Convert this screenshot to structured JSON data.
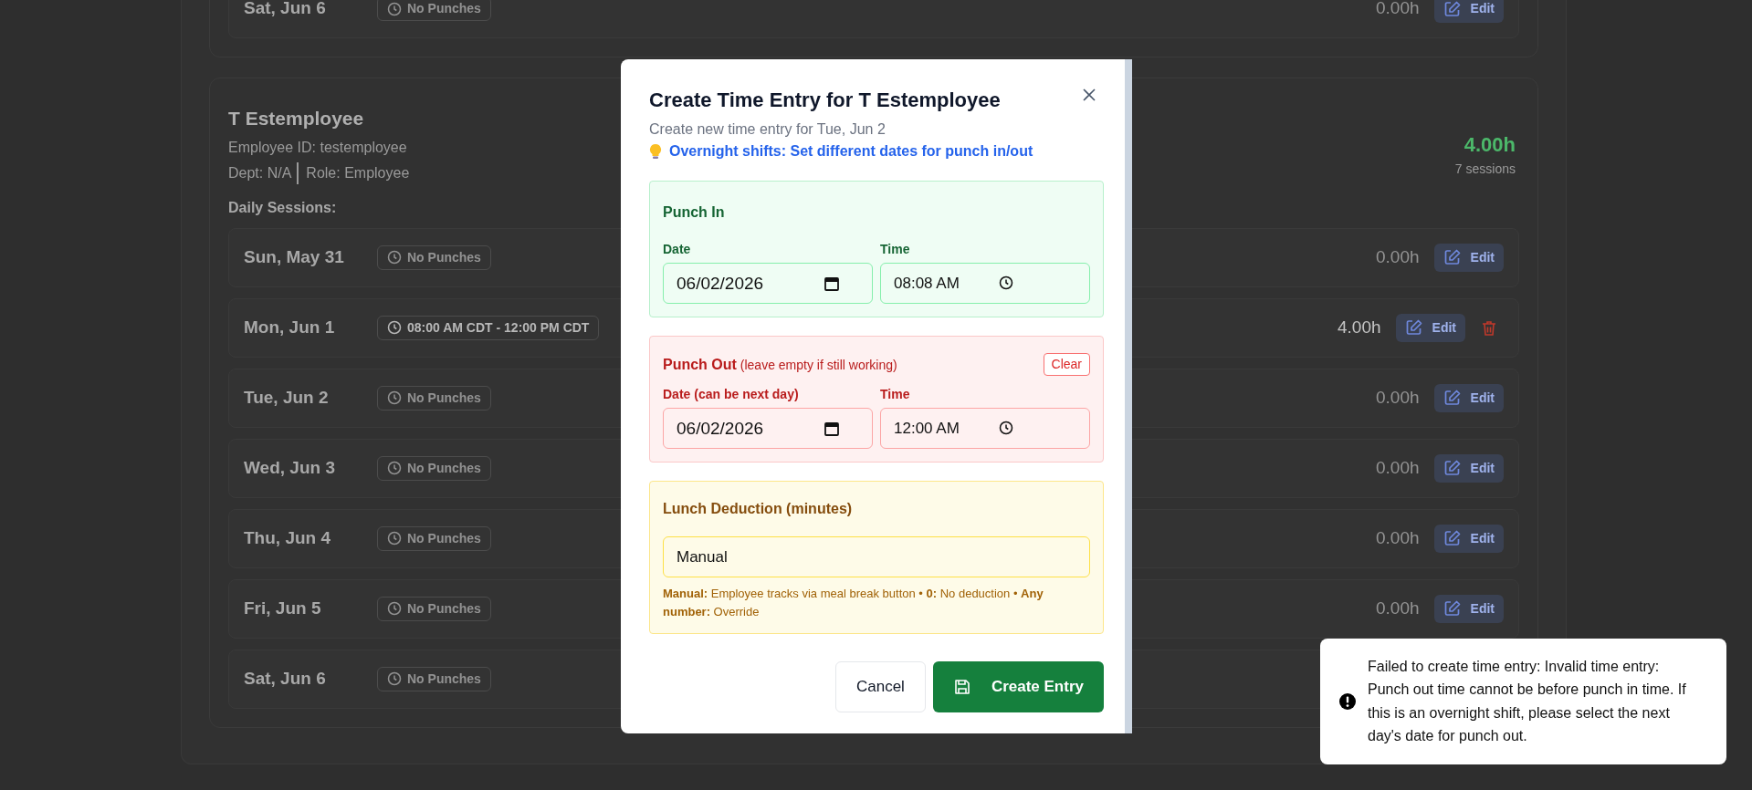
{
  "previous_card": {
    "rows": [
      {
        "day": "Sat, Jun 6",
        "kind": "empty",
        "status": "No Punches",
        "hours": "0.00h",
        "edit": "Edit",
        "deletable": false
      }
    ]
  },
  "employee_card": {
    "name": "T Estemployee",
    "employee_id": "Employee ID: testemployee",
    "dept": "Dept: N/A",
    "role": "Role: Employee",
    "total_hours": "4.00h",
    "sessions": "7 sessions",
    "section_label": "Daily Sessions:",
    "rows": [
      {
        "day": "Sun, May 31",
        "kind": "empty",
        "status": "No Punches",
        "hours": "0.00h",
        "edit": "Edit",
        "deletable": false
      },
      {
        "day": "Mon, Jun 1",
        "kind": "punched",
        "status": "08:00 AM CDT - 12:00 PM CDT",
        "hours": "4.00h",
        "edit": "Edit",
        "deletable": true
      },
      {
        "day": "Tue, Jun 2",
        "kind": "empty",
        "status": "No Punches",
        "hours": "0.00h",
        "edit": "Edit",
        "deletable": false
      },
      {
        "day": "Wed, Jun 3",
        "kind": "empty",
        "status": "No Punches",
        "hours": "0.00h",
        "edit": "Edit",
        "deletable": false
      },
      {
        "day": "Thu, Jun 4",
        "kind": "empty",
        "status": "No Punches",
        "hours": "0.00h",
        "edit": "Edit",
        "deletable": false
      },
      {
        "day": "Fri, Jun 5",
        "kind": "empty",
        "status": "No Punches",
        "hours": "0.00h",
        "edit": "Edit",
        "deletable": false
      },
      {
        "day": "Sat, Jun 6",
        "kind": "empty",
        "status": "No Punches"
      }
    ]
  },
  "modal": {
    "title": "Create Time Entry for T Estemployee",
    "subtitle": "Create new time entry for Tue, Jun 2",
    "tip": "Overnight shifts: Set different dates for punch in/out",
    "sections": [
      {
        "kind": "punch_in",
        "title": "Punch In",
        "fields": [
          {
            "kind": "date",
            "label": "Date",
            "value": "06/02/2026"
          },
          {
            "kind": "time",
            "label": "Time",
            "value": "08:08 AM"
          }
        ]
      },
      {
        "kind": "punch_out",
        "title": "Punch Out",
        "note": "(leave empty if still working)",
        "clear_button": "Clear",
        "fields": [
          {
            "kind": "date",
            "label": "Date (can be next day)",
            "value": "06/02/2026"
          },
          {
            "kind": "time",
            "label": "Time",
            "value": "12:00 AM"
          }
        ]
      },
      {
        "kind": "lunch",
        "title": "Lunch Deduction (minutes)",
        "value": "Manual",
        "help": "**Manual:** Employee tracks via meal break button • **0:** No deduction • **Any number:** Override"
      }
    ],
    "cancel_button": "Cancel",
    "create_button": "Create Entry"
  },
  "toast": {
    "message": "Failed to create time entry: Invalid time entry: Punch out time cannot be before punch in time. If this is an overnight shift, please select the next day's date for punch out."
  }
}
